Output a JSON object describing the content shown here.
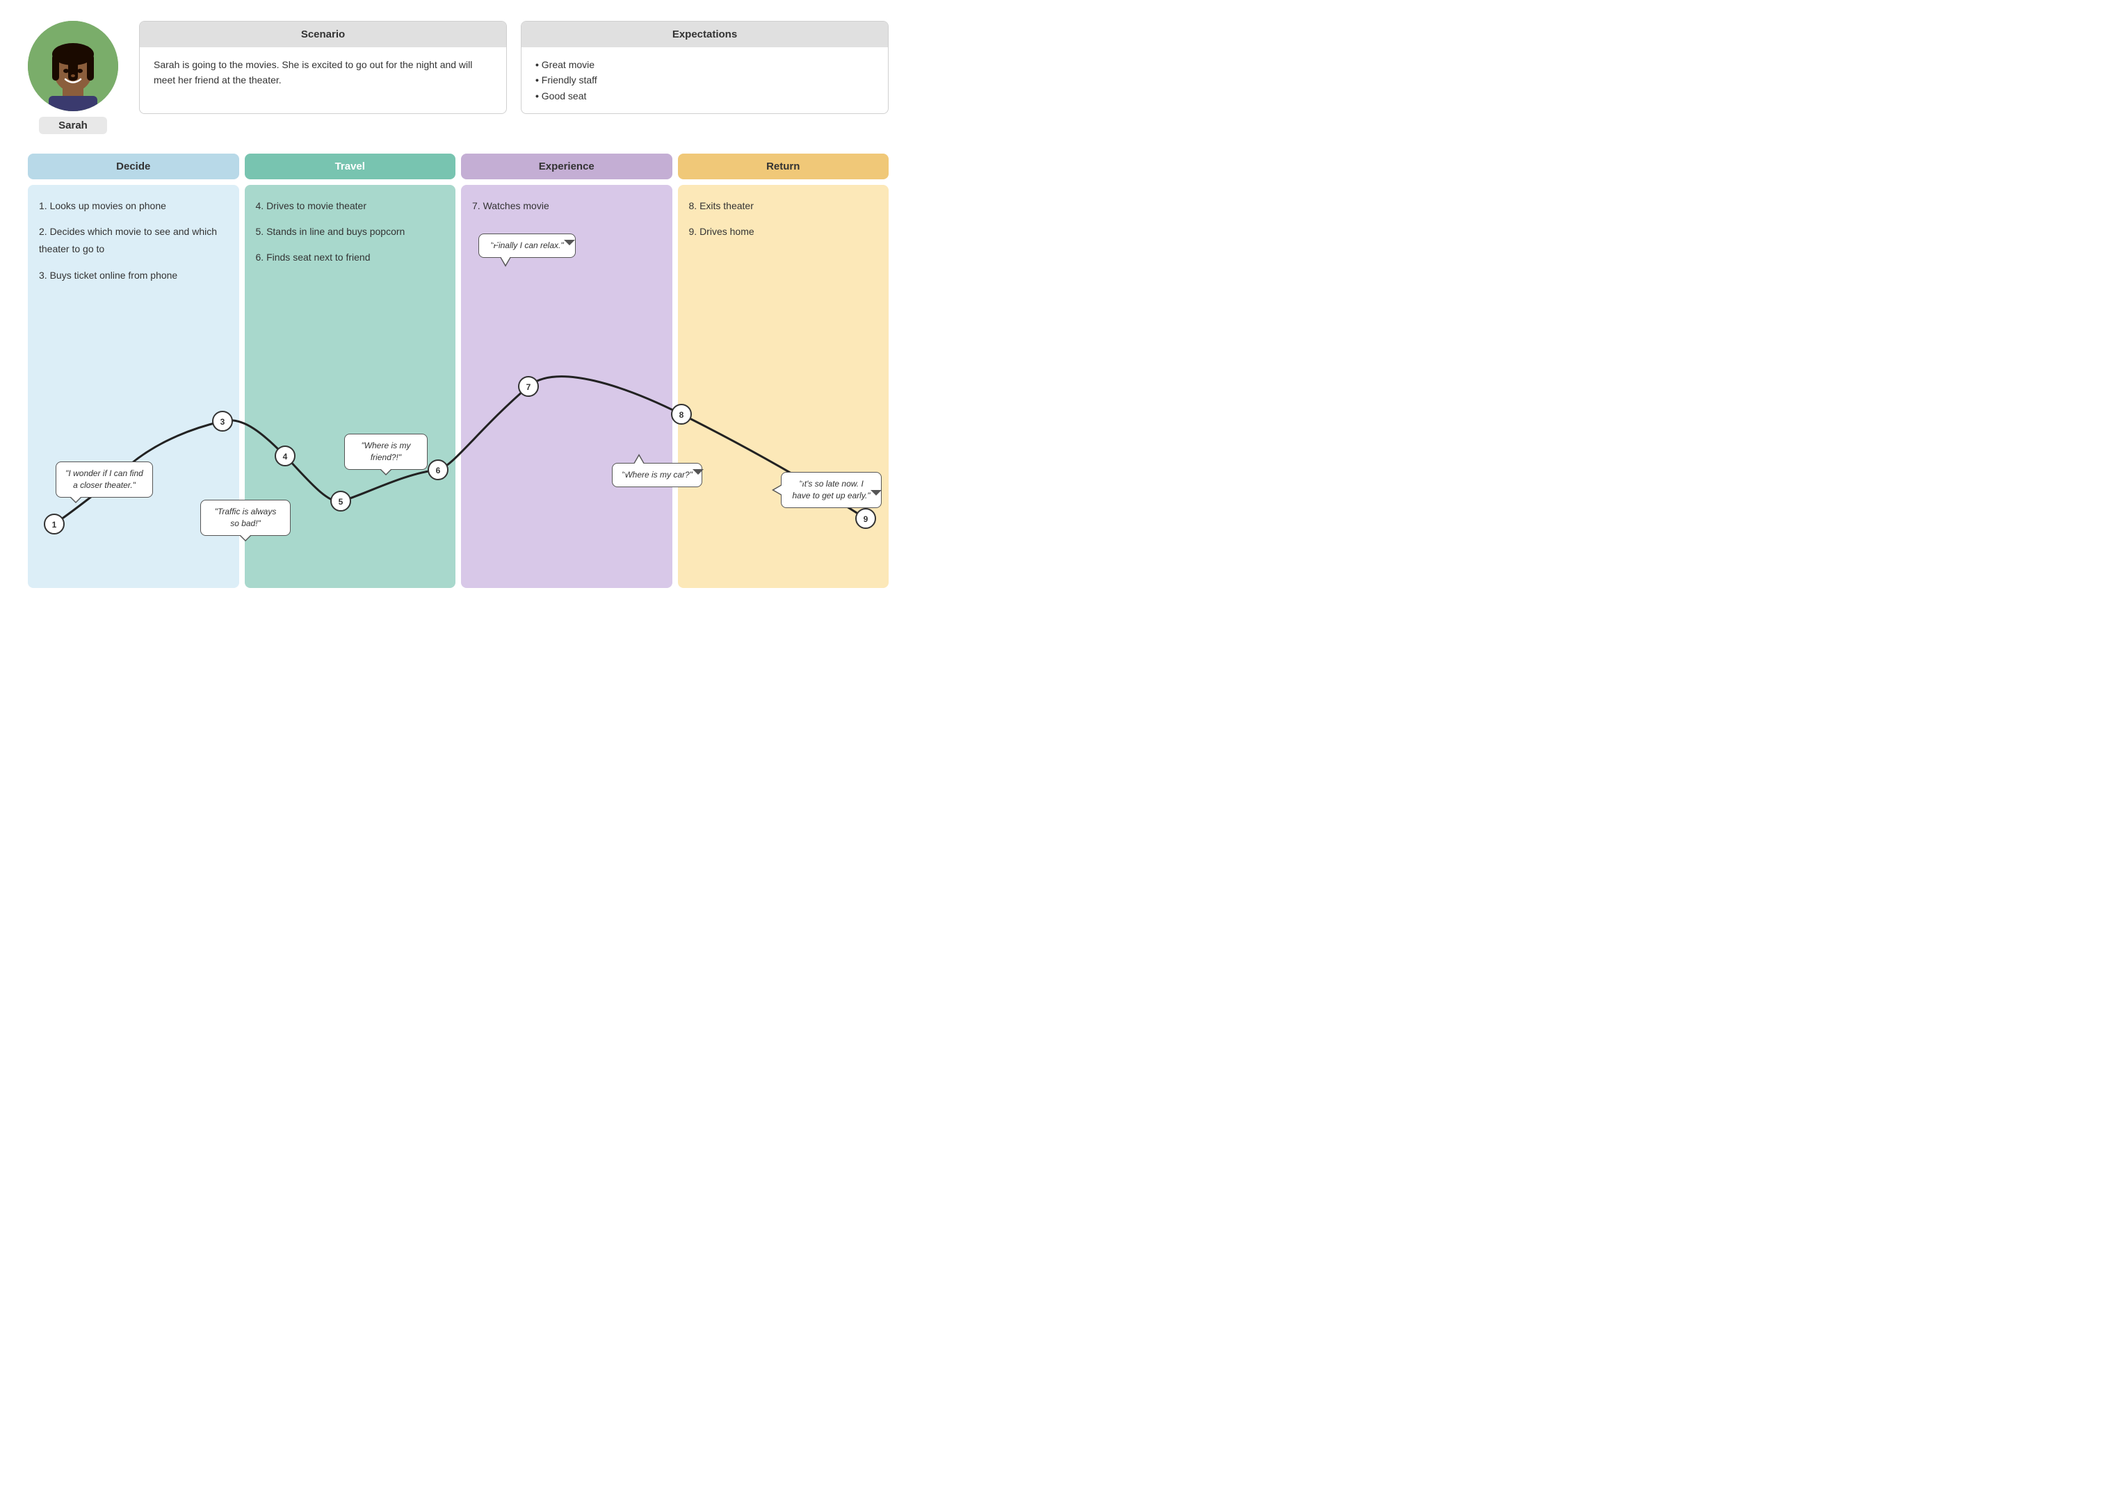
{
  "persona": {
    "name": "Sarah",
    "avatar_desc": "woman with braids smiling outdoors"
  },
  "scenario": {
    "header": "Scenario",
    "body": "Sarah is going to the movies. She is excited to go out for the night and will meet her friend at the theater."
  },
  "expectations": {
    "header": "Expectations",
    "items": [
      "Great movie",
      "Friendly staff",
      "Good seat"
    ]
  },
  "phases": [
    {
      "id": "decide",
      "label": "Decide",
      "color_class": "phase-decide",
      "col_class": "phase-col-decide"
    },
    {
      "id": "travel",
      "label": "Travel",
      "color_class": "phase-travel",
      "col_class": "phase-col-travel"
    },
    {
      "id": "experience",
      "label": "Experience",
      "color_class": "phase-experience",
      "col_class": "phase-col-experience"
    },
    {
      "id": "return",
      "label": "Return",
      "color_class": "phase-return",
      "col_class": "phase-col-return"
    }
  ],
  "steps": {
    "decide": [
      "1.  Looks up movies on phone",
      "2.  Decides which movie to see and which theater to go to",
      "3.  Buys ticket online from phone"
    ],
    "travel": [
      "4.  Drives to movie theater",
      "5.  Stands in line and buys popcorn",
      "6.  Finds seat next to friend"
    ],
    "experience": [
      "7.  Watches movie"
    ],
    "return": [
      "8.  Exits theater",
      "9.  Drives home"
    ]
  },
  "bubbles": [
    {
      "id": 1,
      "text": "\"I wonder if I can find\na closer theater.\"",
      "tail": "bottom-left"
    },
    {
      "id": 4,
      "text": "\"Traffic is always so\nbad!\"",
      "tail": "bottom-center"
    },
    {
      "id": 5,
      "text": "\"Where is my\nfriend?!\"",
      "tail": "bottom-center"
    },
    {
      "id": 7,
      "text": "\"Finally I can relax.\"",
      "tail": "bottom-center"
    },
    {
      "id": 8,
      "text": "\"Where is my car?\"",
      "tail": "top-center"
    },
    {
      "id": 9,
      "text": "\"It's so late now. I\nhave to get up early.\"",
      "tail": "left"
    }
  ]
}
